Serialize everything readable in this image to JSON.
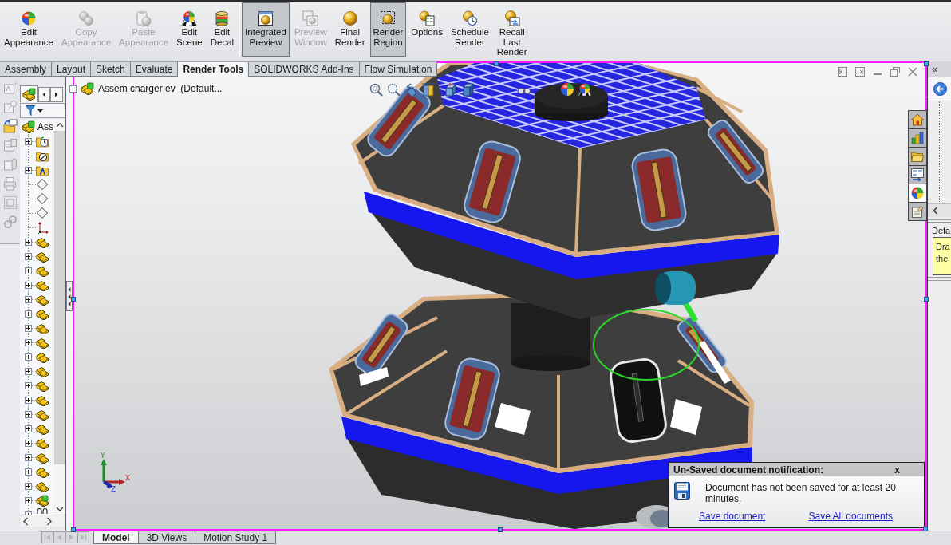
{
  "toolbar": {
    "groups": [
      {
        "buttons": [
          {
            "kind": "appearance",
            "lines": [
              "Edit",
              "Appearance"
            ],
            "disabled": false,
            "pressed": false
          },
          {
            "kind": "copy",
            "lines": [
              "Copy",
              "Appearance"
            ],
            "disabled": true,
            "pressed": false
          },
          {
            "kind": "paste",
            "lines": [
              "Paste",
              "Appearance"
            ],
            "disabled": true,
            "pressed": false
          },
          {
            "kind": "scene",
            "lines": [
              "Edit",
              "Scene"
            ],
            "disabled": false,
            "pressed": false
          },
          {
            "kind": "decal",
            "lines": [
              "Edit",
              "Decal"
            ],
            "disabled": false,
            "pressed": false
          }
        ]
      },
      {
        "buttons": [
          {
            "kind": "integrated-preview",
            "lines": [
              "Integrated",
              "Preview"
            ],
            "disabled": false,
            "pressed": true
          },
          {
            "kind": "preview-window",
            "lines": [
              "Preview",
              "Window"
            ],
            "disabled": true,
            "pressed": false
          },
          {
            "kind": "final-render",
            "lines": [
              "Final",
              "Render"
            ],
            "disabled": false,
            "pressed": false
          },
          {
            "kind": "render-region",
            "lines": [
              "Render",
              "Region"
            ],
            "disabled": false,
            "pressed": true
          },
          {
            "kind": "options",
            "lines": [
              "Options"
            ],
            "disabled": false,
            "pressed": false
          },
          {
            "kind": "schedule",
            "lines": [
              "Schedule",
              "Render"
            ],
            "disabled": false,
            "pressed": false
          },
          {
            "kind": "recall",
            "lines": [
              "Recall",
              "Last",
              "Render"
            ],
            "disabled": false,
            "pressed": false
          }
        ]
      }
    ]
  },
  "tabs": [
    {
      "label": "Assembly",
      "selected": false
    },
    {
      "label": "Layout",
      "selected": false
    },
    {
      "label": "Sketch",
      "selected": false
    },
    {
      "label": "Evaluate",
      "selected": false
    },
    {
      "label": "Render Tools",
      "selected": true
    },
    {
      "label": "SOLIDWORKS Add-Ins",
      "selected": false
    },
    {
      "label": "Flow Simulation",
      "selected": false
    }
  ],
  "side_tools": [
    {
      "kind": "note",
      "disabled": true
    },
    {
      "kind": "balloon",
      "disabled": true
    },
    {
      "kind": "folder",
      "disabled": false
    },
    {
      "kind": "stack",
      "disabled": true
    },
    {
      "kind": "cylinder",
      "disabled": true
    },
    {
      "kind": "printer",
      "disabled": true
    },
    {
      "kind": "frame",
      "disabled": true
    },
    {
      "kind": "link",
      "disabled": true
    }
  ],
  "feature_tree": {
    "root": {
      "label": "Ass"
    },
    "items": [
      {
        "kind": "history",
        "expandable": true
      },
      {
        "kind": "sensors",
        "expandable": false
      },
      {
        "kind": "annotations",
        "expandable": true
      },
      {
        "kind": "plane",
        "expandable": false
      },
      {
        "kind": "plane",
        "expandable": false
      },
      {
        "kind": "plane",
        "expandable": false
      },
      {
        "kind": "origin",
        "expandable": false
      },
      {
        "kind": "part",
        "expandable": true
      },
      {
        "kind": "part",
        "expandable": true
      },
      {
        "kind": "part",
        "expandable": true
      },
      {
        "kind": "part",
        "expandable": true
      },
      {
        "kind": "part",
        "expandable": true
      },
      {
        "kind": "part",
        "expandable": true
      },
      {
        "kind": "part",
        "expandable": true
      },
      {
        "kind": "part",
        "expandable": true
      },
      {
        "kind": "part",
        "expandable": true
      },
      {
        "kind": "part",
        "expandable": true
      },
      {
        "kind": "part",
        "expandable": true
      },
      {
        "kind": "part",
        "expandable": true
      },
      {
        "kind": "part",
        "expandable": true
      },
      {
        "kind": "part",
        "expandable": true
      },
      {
        "kind": "part",
        "expandable": true
      },
      {
        "kind": "part",
        "expandable": true
      },
      {
        "kind": "part",
        "expandable": true
      },
      {
        "kind": "part",
        "expandable": true
      },
      {
        "kind": "subassembly",
        "expandable": true
      },
      {
        "kind": "mates",
        "expandable": true
      }
    ]
  },
  "viewport": {
    "flyout": {
      "expanded": false,
      "label": "Assem charger ev  (Default..."
    },
    "triad": {
      "x": "X",
      "y": "Y",
      "z": "Z"
    }
  },
  "task_pane_tabs": [
    {
      "kind": "home",
      "selected": false
    },
    {
      "kind": "resources",
      "selected": false
    },
    {
      "kind": "library",
      "selected": false
    },
    {
      "kind": "view-palette",
      "selected": false
    },
    {
      "kind": "appearances",
      "selected": true
    },
    {
      "kind": "properties",
      "selected": false
    }
  ],
  "task_pane": {
    "collapse": "«",
    "label": "Defa",
    "hint": [
      "Dra",
      "the"
    ]
  },
  "notification": {
    "title": "Un-Saved document notification:",
    "close": "x",
    "message": "Document has not been saved for at least 20 minutes.",
    "links": [
      "Save document",
      "Save All documents"
    ]
  },
  "bottom_nav": [
    {
      "kind": "first",
      "disabled": true
    },
    {
      "kind": "previous",
      "disabled": true
    },
    {
      "kind": "next",
      "disabled": true
    },
    {
      "kind": "last",
      "disabled": true
    }
  ],
  "bottom_tabs": [
    {
      "label": "Model",
      "selected": true
    },
    {
      "label": "3D Views",
      "selected": false
    },
    {
      "label": "Motion Study 1",
      "selected": false
    }
  ]
}
